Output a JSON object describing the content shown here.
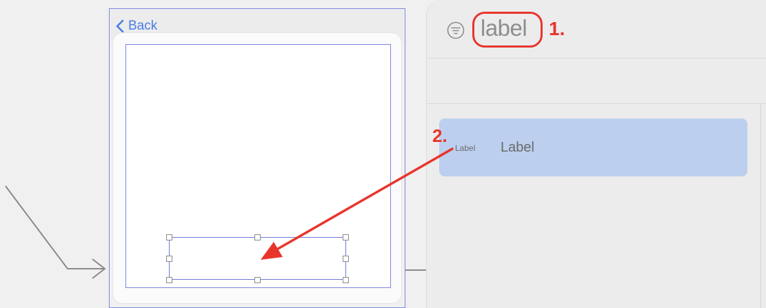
{
  "navigation": {
    "back_label": "Back"
  },
  "library": {
    "search_query": "label",
    "result": {
      "thumbnail_label": "Label",
      "name": "Label"
    }
  },
  "annotations": {
    "step1": "1.",
    "step2": "2.",
    "color": "#e8352c"
  },
  "icons": {
    "back": "chevron-left-icon",
    "filter": "filter-icon"
  },
  "colors": {
    "selection": "#7b86e0",
    "accent": "#4a7ce6",
    "result_highlight": "#bccfee"
  }
}
